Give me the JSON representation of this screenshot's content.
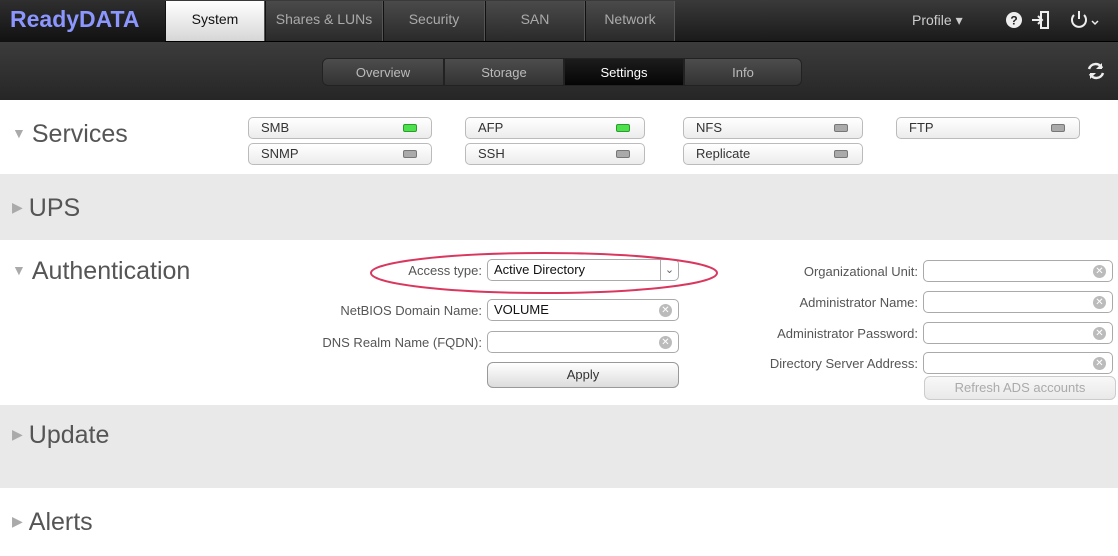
{
  "app": {
    "logo": "ReadyDATA"
  },
  "nav": {
    "tabs": [
      {
        "label": "System",
        "active": true
      },
      {
        "label": "Shares & LUNs",
        "active": false
      },
      {
        "label": "Security",
        "active": false
      },
      {
        "label": "SAN",
        "active": false
      },
      {
        "label": "Network",
        "active": false
      }
    ],
    "profile_label": "Profile ▾",
    "icons": [
      "help-icon",
      "logout-icon",
      "power-icon"
    ]
  },
  "subnav": {
    "tabs": [
      {
        "label": "Overview",
        "active": false
      },
      {
        "label": "Storage",
        "active": false
      },
      {
        "label": "Settings",
        "active": true
      },
      {
        "label": "Info",
        "active": false
      }
    ]
  },
  "services": {
    "title": "Services",
    "items": [
      {
        "name": "SMB",
        "enabled": true
      },
      {
        "name": "AFP",
        "enabled": true
      },
      {
        "name": "NFS",
        "enabled": false
      },
      {
        "name": "FTP",
        "enabled": false
      },
      {
        "name": "SNMP",
        "enabled": false
      },
      {
        "name": "SSH",
        "enabled": false
      },
      {
        "name": "Replicate",
        "enabled": false
      }
    ]
  },
  "ups": {
    "title": "UPS"
  },
  "auth": {
    "title": "Authentication",
    "access_type_label": "Access type:",
    "access_type_value": "Active Directory",
    "netbios_label": "NetBIOS Domain Name:",
    "netbios_value": "VOLUME",
    "dns_label": "DNS Realm Name (FQDN):",
    "dns_value": "",
    "apply_label": "Apply",
    "ou_label": "Organizational Unit:",
    "admin_name_label": "Administrator Name:",
    "admin_password_label": "Administrator Password:",
    "dir_server_label": "Directory Server Address:",
    "refresh_label": "Refresh ADS accounts",
    "highlight_color": "#d9375e"
  },
  "update": {
    "title": "Update"
  },
  "alerts": {
    "title": "Alerts"
  }
}
